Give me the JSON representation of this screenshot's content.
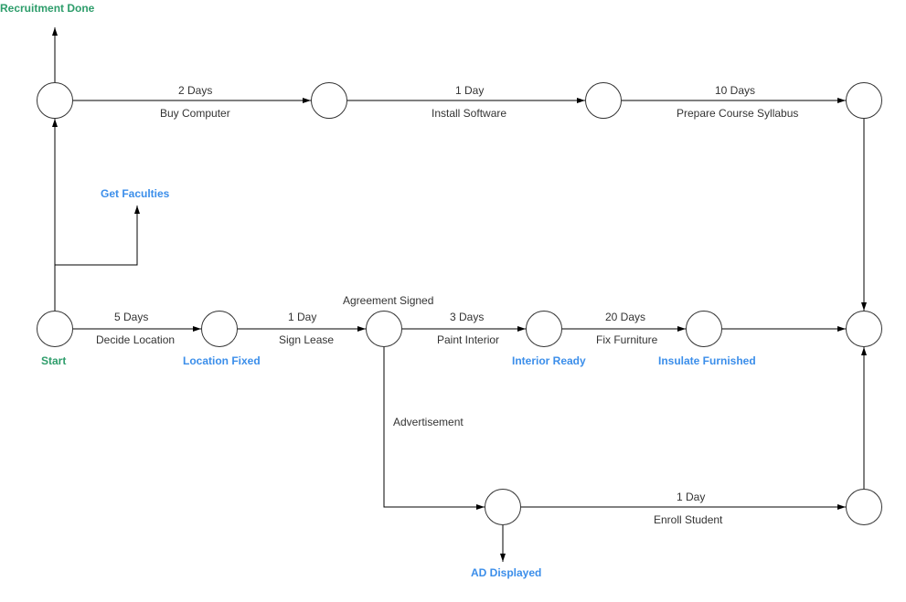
{
  "title": "Recruitment Done",
  "nodes": {
    "start": {
      "label": "Start"
    },
    "locationFixed": {
      "label": "Location Fixed"
    },
    "agreementSigned": {
      "label": "Agreement Signed"
    },
    "interiorReady": {
      "label": "Interior Ready"
    },
    "insulateFurnished": {
      "label": "Insulate Furnished"
    },
    "adDisplayed": {
      "label": "AD Displayed"
    },
    "getFaculties": {
      "label": "Get Faculties"
    }
  },
  "edges": {
    "decideLocation": {
      "duration": "5 Days",
      "task": "Decide Location"
    },
    "signLease": {
      "duration": "1 Day",
      "task": "Sign Lease"
    },
    "paintInterior": {
      "duration": "3 Days",
      "task": "Paint Interior"
    },
    "fixFurniture": {
      "duration": "20 Days",
      "task": "Fix Furniture"
    },
    "advertisement": {
      "task": "Advertisement"
    },
    "enrollStudent": {
      "duration": "1 Day",
      "task": "Enroll Student"
    },
    "buyComputer": {
      "duration": "2 Days",
      "task": "Buy Computer"
    },
    "installSoftware": {
      "duration": "1 Day",
      "task": "Install Software"
    },
    "prepareSyllabus": {
      "duration": "10 Days",
      "task": "Prepare Course Syllabus"
    }
  }
}
